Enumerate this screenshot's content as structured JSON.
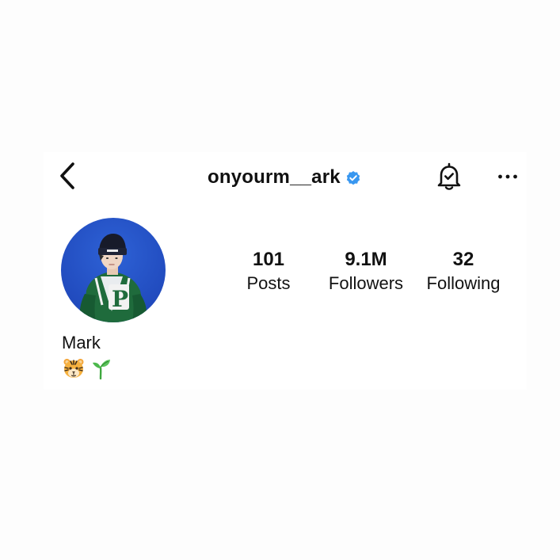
{
  "header": {
    "username": "onyourm__ark",
    "verified": true,
    "icons": {
      "back": "chevron-left-icon",
      "notifications": "bell-check-icon",
      "more": "more-horizontal-icon",
      "verified": "verified-badge-icon"
    },
    "accent_color": "#3897f0"
  },
  "profile": {
    "display_name": "Mark",
    "bio_emojis": [
      "tiger-face-emoji",
      "seedling-emoji"
    ]
  },
  "stats": [
    {
      "value": "101",
      "label": "Posts"
    },
    {
      "value": "9.1M",
      "label": "Followers"
    },
    {
      "value": "32",
      "label": "Following"
    }
  ]
}
